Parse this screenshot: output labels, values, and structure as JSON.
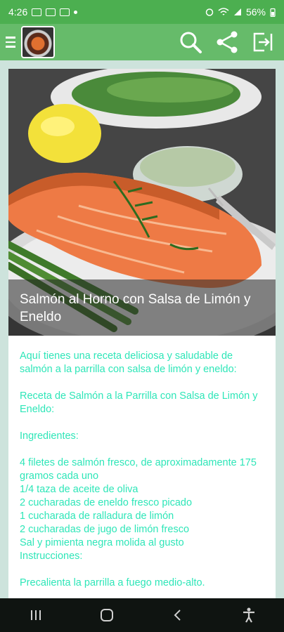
{
  "status_bar": {
    "time": "4:26",
    "battery": "56%"
  },
  "app_bar": {
    "icons": [
      "menu-icon",
      "search-icon",
      "share-icon",
      "exit-icon"
    ]
  },
  "recipe": {
    "title": "Salmón al Horno con Salsa de Limón y Eneldo",
    "intro": "Aquí tienes una receta deliciosa y saludable de salmón a la parrilla con salsa de limón y eneldo:",
    "subtitle": "Receta de Salmón a la Parrilla con Salsa de Limón y Eneldo:",
    "ingredients_heading": "Ingredientes:",
    "ingredients": [
      "4 filetes de salmón fresco, de aproximadamente 175 gramos cada uno",
      "1/4 taza de aceite de oliva",
      "2 cucharadas de eneldo fresco picado",
      "1 cucharada de ralladura de limón",
      "2 cucharadas de jugo de limón fresco",
      "Sal y pimienta negra molida al gusto"
    ],
    "instructions_heading": "Instrucciones:",
    "step1": "Precalienta la parrilla a fuego medio-alto."
  },
  "colors": {
    "status_bar": "#4caf50",
    "app_bar": "#66bb6a",
    "body_text": "#2ee6b8",
    "background": "#cde3dc"
  }
}
